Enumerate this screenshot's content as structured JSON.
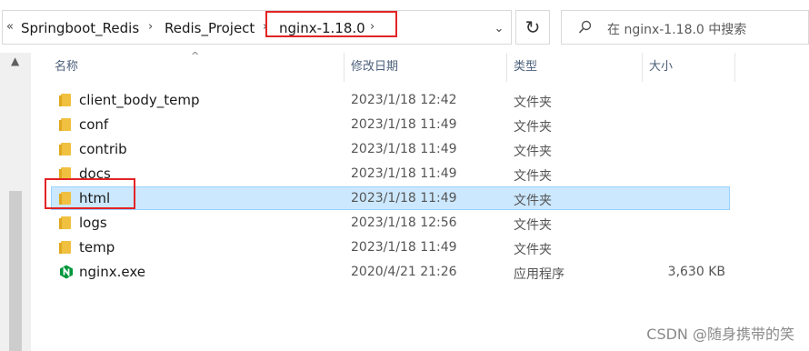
{
  "breadcrumb": {
    "items": [
      "Springboot_Redis",
      "Redis_Project",
      "nginx-1.18.0"
    ]
  },
  "search": {
    "placeholder": "在 nginx-1.18.0 中搜索"
  },
  "columns": {
    "name": "名称",
    "date": "修改日期",
    "type": "类型",
    "size": "大小"
  },
  "files": [
    {
      "name": "client_body_temp",
      "date": "2023/1/18 12:42",
      "type": "文件夹",
      "size": "",
      "icon": "folder-icon"
    },
    {
      "name": "conf",
      "date": "2023/1/18 11:49",
      "type": "文件夹",
      "size": "",
      "icon": "folder-icon"
    },
    {
      "name": "contrib",
      "date": "2023/1/18 11:49",
      "type": "文件夹",
      "size": "",
      "icon": "folder-icon"
    },
    {
      "name": "docs",
      "date": "2023/1/18 11:49",
      "type": "文件夹",
      "size": "",
      "icon": "folder-icon"
    },
    {
      "name": "html",
      "date": "2023/1/18 11:49",
      "type": "文件夹",
      "size": "",
      "icon": "folder-icon",
      "selected": true
    },
    {
      "name": "logs",
      "date": "2023/1/18 12:56",
      "type": "文件夹",
      "size": "",
      "icon": "folder-icon"
    },
    {
      "name": "temp",
      "date": "2023/1/18 11:49",
      "type": "文件夹",
      "size": "",
      "icon": "folder-icon"
    },
    {
      "name": "nginx.exe",
      "date": "2020/4/21 21:26",
      "type": "应用程序",
      "size": "3,630 KB",
      "icon": "nginx-app-icon"
    }
  ],
  "watermark": "CSDN @随身携带的笑",
  "colors": {
    "highlight_box": "#e32424",
    "selection_bg": "#cce8ff",
    "folder": "#f0c040",
    "nginx": "#00963a"
  }
}
